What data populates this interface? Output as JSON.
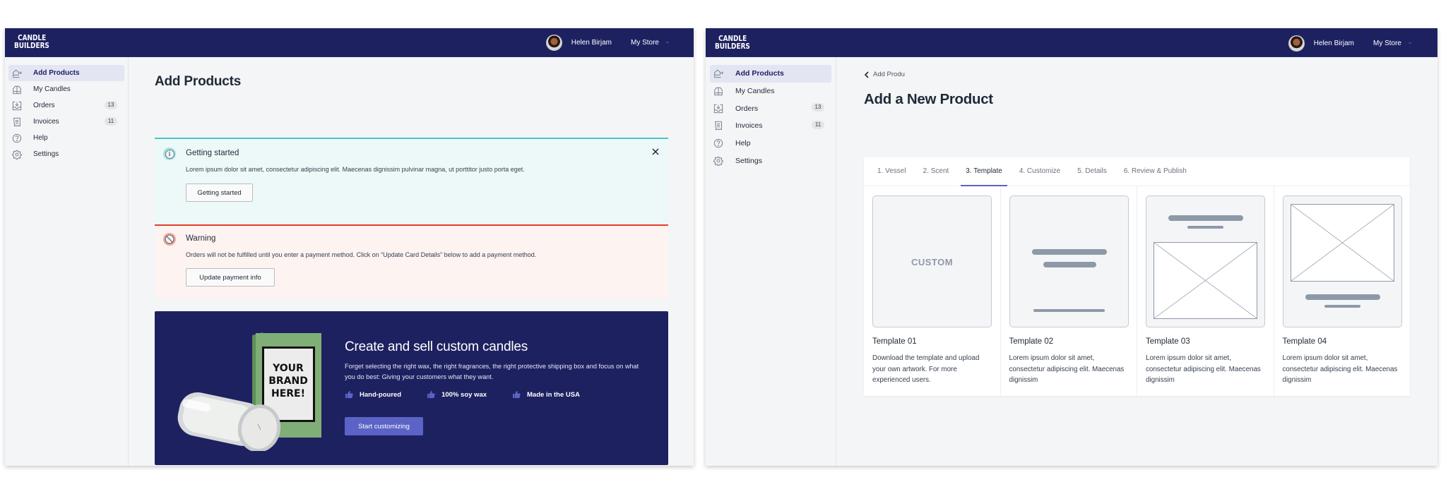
{
  "brand": {
    "logo_line1": "CANDLE",
    "logo_line2": "BUILDERS"
  },
  "user": {
    "name": "Helen Birjam",
    "store": "My Store"
  },
  "colors": {
    "nav_bg": "#1e2160",
    "accent": "#5b63c6",
    "info": "#4fc4c4",
    "warning": "#e0402a"
  },
  "sidebar": {
    "items": [
      {
        "label": "Add Products",
        "icon": "add-products-icon",
        "active": true
      },
      {
        "label": "My Candles",
        "icon": "candles-icon"
      },
      {
        "label": "Orders",
        "icon": "orders-icon",
        "badge": "13"
      },
      {
        "label": "Invoices",
        "icon": "invoice-icon",
        "badge": "11"
      },
      {
        "label": "Help",
        "icon": "help-icon"
      },
      {
        "label": "Settings",
        "icon": "gear-icon"
      }
    ]
  },
  "screen1": {
    "title": "Add Products",
    "info_alert": {
      "title": "Getting started",
      "text": "Lorem ipsum dolor sit amet, consectetur adipiscing elit. Maecenas dignissim pulvinar magna, ut porttitor justo porta eget.",
      "button": "Getting started"
    },
    "warning_alert": {
      "title": "Warning",
      "text": "Orders will not be fulfilled until you enter a payment method. Click on “Update Card Details” below to add a payment method.",
      "button": "Update payment info"
    },
    "promo": {
      "box_text_1": "YOUR",
      "box_text_2": "BRAND",
      "box_text_3": "HERE!",
      "title": "Create and sell custom candles",
      "text": "Forget selecting the right wax, the right fragrances, the right protective shipping box and focus on what you do best: Giving your customers what they want.",
      "features": [
        "Hand-poured",
        "100% soy wax",
        "Made in the USA"
      ],
      "button": "Start customizing"
    }
  },
  "screen2": {
    "back_label": "Add Produ",
    "title": "Add a New Product",
    "tabs": [
      {
        "label": "1. Vessel"
      },
      {
        "label": "2. Scent"
      },
      {
        "label": "3. Template",
        "active": true
      },
      {
        "label": "4. Customize"
      },
      {
        "label": "5. Details"
      },
      {
        "label": "6. Review & Publish"
      }
    ],
    "templates": [
      {
        "title": "Template 01",
        "thumb_label": "CUSTOM",
        "desc": "Download the template and upload your own artwork. For more experienced users."
      },
      {
        "title": "Template 02",
        "desc": "Lorem ipsum dolor sit amet, consectetur adipiscing elit. Maecenas dignissim"
      },
      {
        "title": "Template 03",
        "desc": "Lorem ipsum dolor sit amet, consectetur adipiscing elit. Maecenas dignissim"
      },
      {
        "title": "Template 04",
        "desc": "Lorem ipsum dolor sit amet, consectetur adipiscing elit. Maecenas dignissim"
      }
    ]
  }
}
